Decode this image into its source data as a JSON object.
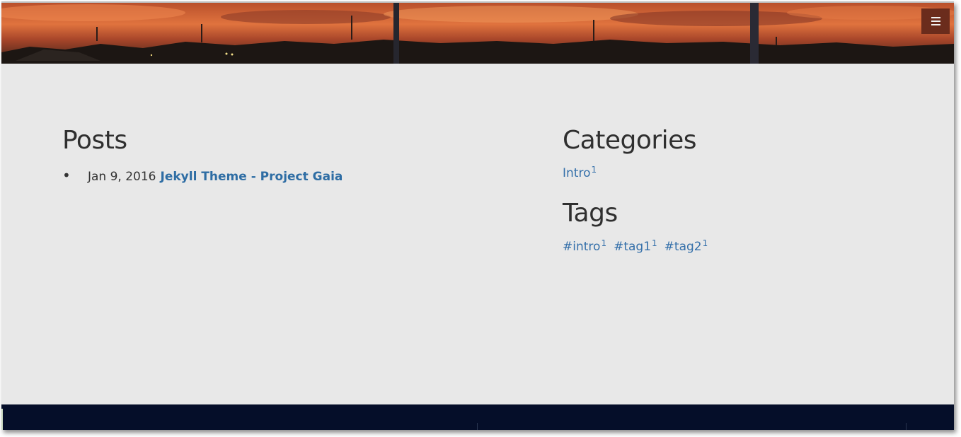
{
  "header": {
    "menu_icon": "hamburger-icon",
    "banner": "sunset-landscape-banner"
  },
  "posts": {
    "title": "Posts",
    "items": [
      {
        "date": "Jan 9, 2016",
        "title": "Jekyll Theme - Project Gaia"
      }
    ]
  },
  "categories": {
    "title": "Categories",
    "items": [
      {
        "label": "Intro",
        "count": "1"
      }
    ]
  },
  "tags": {
    "title": "Tags",
    "items": [
      {
        "label": "#intro",
        "count": "1"
      },
      {
        "label": "#tag1",
        "count": "1"
      },
      {
        "label": "#tag2",
        "count": "1"
      }
    ]
  },
  "colors": {
    "background": "#e8e8e8",
    "link": "#2e6da4",
    "footer": "#050e29",
    "menu_button": "#6b2c1c"
  }
}
